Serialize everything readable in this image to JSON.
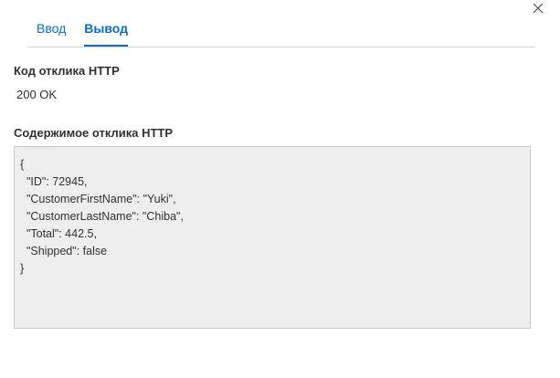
{
  "dialog": {
    "close_icon": "close-icon"
  },
  "tabs": [
    {
      "label": "Ввод",
      "active": false
    },
    {
      "label": "Вывод",
      "active": true
    }
  ],
  "status": {
    "label": "Код отклика HTTP",
    "value": "200 OK"
  },
  "response": {
    "label": "Содержимое отклика HTTP",
    "body": "{\n  \"ID\": 72945,\n  \"CustomerFirstName\": \"Yuki\",\n  \"CustomerLastName\": \"Chiba\",\n  \"Total\": 442.5,\n  \"Shipped\": false\n}"
  },
  "colors": {
    "accent": "#0f6cbd",
    "text": "#323130",
    "content_background": "#eeeeee",
    "border": "#c8c8c8"
  }
}
